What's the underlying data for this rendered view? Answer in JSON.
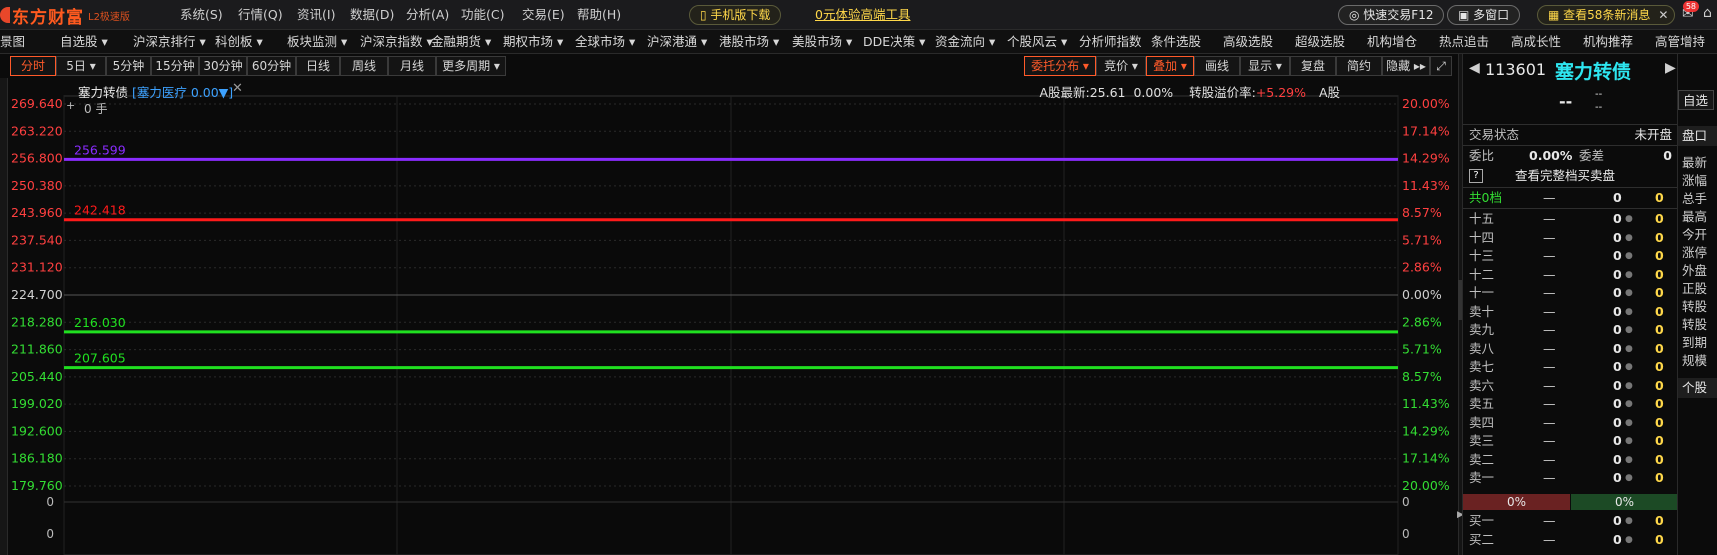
{
  "app": {
    "logo_text": "东方财富",
    "logo_sub": "L2极速版"
  },
  "top_menu": [
    "系统(S)",
    "行情(Q)",
    "资讯(I)",
    "数据(D)",
    "分析(A)",
    "功能(C)",
    "交易(E)",
    "帮助(H)"
  ],
  "top_buttons": {
    "mobile_download": "手机版下载",
    "free_trial": "0元体验高端工具",
    "quick_trade": "快速交易F12",
    "multi_window": "多窗口",
    "messages": "查看58条新消息",
    "message_badge": "58"
  },
  "nav": [
    {
      "label": "景图",
      "x": 0
    },
    {
      "label": "自选股 ▾",
      "x": 60
    },
    {
      "label": "沪深京排行 ▾",
      "x": 133
    },
    {
      "label": "科创板 ▾",
      "x": 215
    },
    {
      "label": "板块监测 ▾",
      "x": 287
    },
    {
      "label": "沪深京指数 ▾",
      "x": 360
    },
    {
      "label": "金融期货 ▾",
      "x": 431
    },
    {
      "label": "期权市场 ▾",
      "x": 503
    },
    {
      "label": "全球市场 ▾",
      "x": 575
    },
    {
      "label": "沪深港通 ▾",
      "x": 647
    },
    {
      "label": "港股市场 ▾",
      "x": 719
    },
    {
      "label": "美股市场 ▾",
      "x": 792
    },
    {
      "label": "DDE决策 ▾",
      "x": 863
    },
    {
      "label": "资金流向 ▾",
      "x": 935
    },
    {
      "label": "个股风云 ▾",
      "x": 1007
    },
    {
      "label": "分析师指数",
      "x": 1079
    },
    {
      "label": "条件选股",
      "x": 1151
    },
    {
      "label": "高级选股",
      "x": 1223
    },
    {
      "label": "超级选股",
      "x": 1295
    },
    {
      "label": "机构增仓",
      "x": 1367
    },
    {
      "label": "热点追击",
      "x": 1439
    },
    {
      "label": "高成长性",
      "x": 1511
    },
    {
      "label": "机构推荐",
      "x": 1583
    },
    {
      "label": "高管增持",
      "x": 1655
    }
  ],
  "chart_toolbar": {
    "periods": [
      "分时",
      "5日 ▾",
      "5分钟",
      "15分钟",
      "30分钟",
      "60分钟",
      "日线",
      "周线",
      "月线",
      "更多周期 ▾"
    ],
    "right": [
      "委托分布 ▾",
      "竞价 ▾",
      "叠加 ▾",
      "画线",
      "显示 ▾",
      "复盘",
      "简约",
      "隐藏 ▸▸",
      "⤢"
    ]
  },
  "chart_header": {
    "name": "塞力转债",
    "overlay": "[塞力医疗 0.00▼]",
    "a_share_latest": "A股最新:25.61",
    "a_share_pct": "0.00%",
    "premium_label": "转股溢价率:",
    "premium_value": "+5.29%",
    "a_tag": "A股",
    "volume_label": "0 手",
    "sub_axis_top": "0",
    "sub_axis_bottom": "0"
  },
  "chart_data": {
    "type": "line",
    "price_ticks": [
      "269.640",
      "263.220",
      "256.800",
      "250.380",
      "243.960",
      "237.540",
      "231.120",
      "224.700",
      "218.280",
      "211.860",
      "205.440",
      "199.020",
      "192.600",
      "186.180",
      "179.760"
    ],
    "pct_ticks": [
      "20.00%",
      "17.14%",
      "14.29%",
      "11.43%",
      "8.57%",
      "5.71%",
      "2.86%",
      "0.00%",
      "2.86%",
      "5.71%",
      "8.57%",
      "11.43%",
      "14.29%",
      "17.14%",
      "20.00%"
    ],
    "ylim": [
      179.76,
      269.64
    ],
    "reference_lines": [
      {
        "value": 256.599,
        "label": "256.599",
        "color": "#8a2cff"
      },
      {
        "value": 242.418,
        "label": "242.418",
        "color": "#ff1a1a"
      },
      {
        "value": 216.03,
        "label": "216.030",
        "color": "#20e020"
      },
      {
        "value": 207.605,
        "label": "207.605",
        "color": "#20e020"
      }
    ],
    "colors": {
      "up": "#ff4040",
      "flat": "#d0d0d0",
      "down": "#33dd33"
    }
  },
  "right_panel": {
    "code": "113601",
    "name": "塞力转债",
    "price": "--",
    "change": "--",
    "change_pct": "--",
    "status_label": "交易状态",
    "status_value": "未开盘",
    "weibi_label": "委比",
    "weibi_value": "0.00%",
    "weicha_label": "委差",
    "weicha_value": "0",
    "full_depth": "查看完整档买卖盘",
    "help_icon": "?",
    "total_label": "共0档",
    "sell_rows": [
      "十五",
      "十四",
      "十三",
      "十二",
      "十一",
      "卖十",
      "卖九",
      "卖八",
      "卖七",
      "卖六",
      "卖五",
      "卖四",
      "卖三",
      "卖二",
      "卖一"
    ],
    "buy_rows": [
      "买一",
      "买二"
    ],
    "dash": "—",
    "zero": "0",
    "sell_ratio": "0%",
    "buy_ratio": "0%"
  },
  "far_right": {
    "tab_top": "自选",
    "tab_mid": "盘口",
    "items": [
      "最新",
      "涨幅",
      "总手",
      "最高",
      "今开",
      "涨停",
      "外盘",
      "正股",
      "转股",
      "转股",
      "到期",
      "规模"
    ],
    "tab_bottom": "个股"
  }
}
